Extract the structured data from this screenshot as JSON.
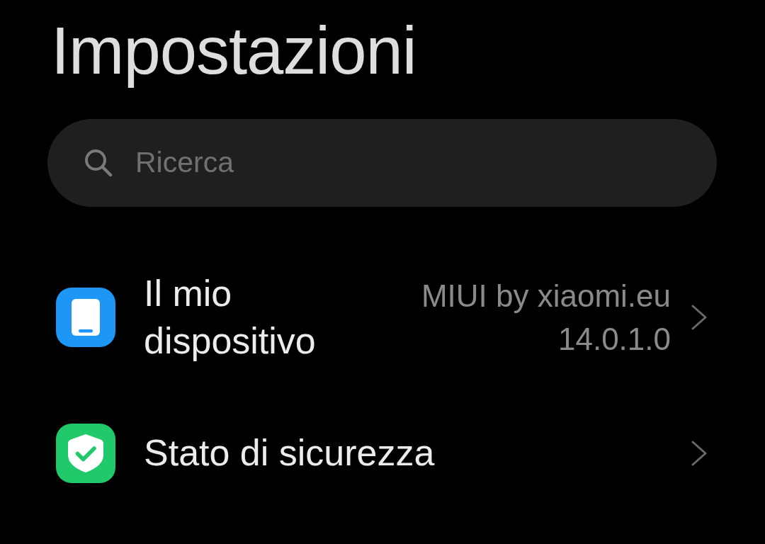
{
  "title": "Impostazioni",
  "search": {
    "placeholder": "Ricerca"
  },
  "items": [
    {
      "label": "Il mio dispositivo",
      "value": "MIUI by xiaomi.eu 14.0.1.0",
      "color": "#1e96f5"
    },
    {
      "label": "Stato di sicurezza",
      "color": "#20c96a"
    }
  ]
}
